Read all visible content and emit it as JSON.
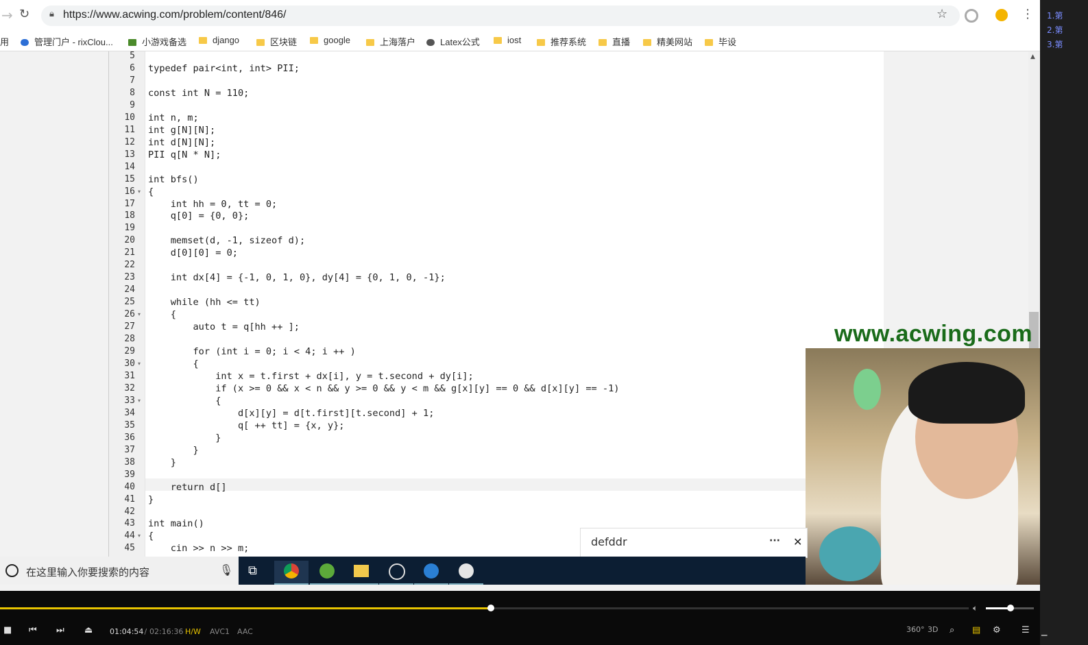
{
  "browser": {
    "url": "https://www.acwing.com/problem/content/846/",
    "bookmarks": [
      "用",
      "管理门户 - rixClou...",
      "小游戏备选",
      "django",
      "区块链",
      "google",
      "上海落户",
      "Latex公式",
      "iost",
      "推荐系统",
      "直播",
      "精美网站",
      "毕设"
    ]
  },
  "editor": {
    "line_numbers": [
      "5",
      "6",
      "7",
      "8",
      "9",
      "10",
      "11",
      "12",
      "13",
      "14",
      "15",
      "16",
      "17",
      "18",
      "19",
      "20",
      "21",
      "22",
      "23",
      "24",
      "25",
      "26",
      "27",
      "28",
      "29",
      "30",
      "31",
      "32",
      "33",
      "34",
      "35",
      "36",
      "37",
      "38",
      "39",
      "40",
      "41",
      "42",
      "43",
      "44",
      "45"
    ],
    "lines": [
      "",
      "typedef pair<int, int> PII;",
      "",
      "const int N = 110;",
      "",
      "int n, m;",
      "int g[N][N];",
      "int d[N][N];",
      "PII q[N * N];",
      "",
      "int bfs()",
      "{",
      "    int hh = 0, tt = 0;",
      "    q[0] = {0, 0};",
      "",
      "    memset(d, -1, sizeof d);",
      "    d[0][0] = 0;",
      "",
      "    int dx[4] = {-1, 0, 1, 0}, dy[4] = {0, 1, 0, -1};",
      "",
      "    while (hh <= tt)",
      "    {",
      "        auto t = q[hh ++ ];",
      "",
      "        for (int i = 0; i < 4; i ++ )",
      "        {",
      "            int x = t.first + dx[i], y = t.second + dy[i];",
      "            if (x >= 0 && x < n && y >= 0 && y < m && g[x][y] == 0 && d[x][y] == -1)",
      "            {",
      "                d[x][y] = d[t.first][t.second] + 1;",
      "                q[ ++ tt] = {x, y};",
      "            }",
      "        }",
      "    }",
      "",
      "    return d[]",
      "}",
      "",
      "int main()",
      "{",
      "    cin >> n >> m;"
    ]
  },
  "watermark": "www.acwing.com",
  "notification": {
    "title": "defddr",
    "more": "···",
    "close": "✕"
  },
  "taskbar": {
    "search_placeholder": "在这里输入你要搜索的内容"
  },
  "player": {
    "current_time": "01:04:54",
    "separator": " / ",
    "total_time": "02:16:36",
    "hw": "H/W",
    "video_codec": "AVC1",
    "audio_codec": "AAC",
    "progress": 0.507,
    "volume": 0.52,
    "btn_360": "360°",
    "btn_3d": "3D"
  },
  "playlist": [
    "1.第",
    "2.第",
    "3.第"
  ]
}
